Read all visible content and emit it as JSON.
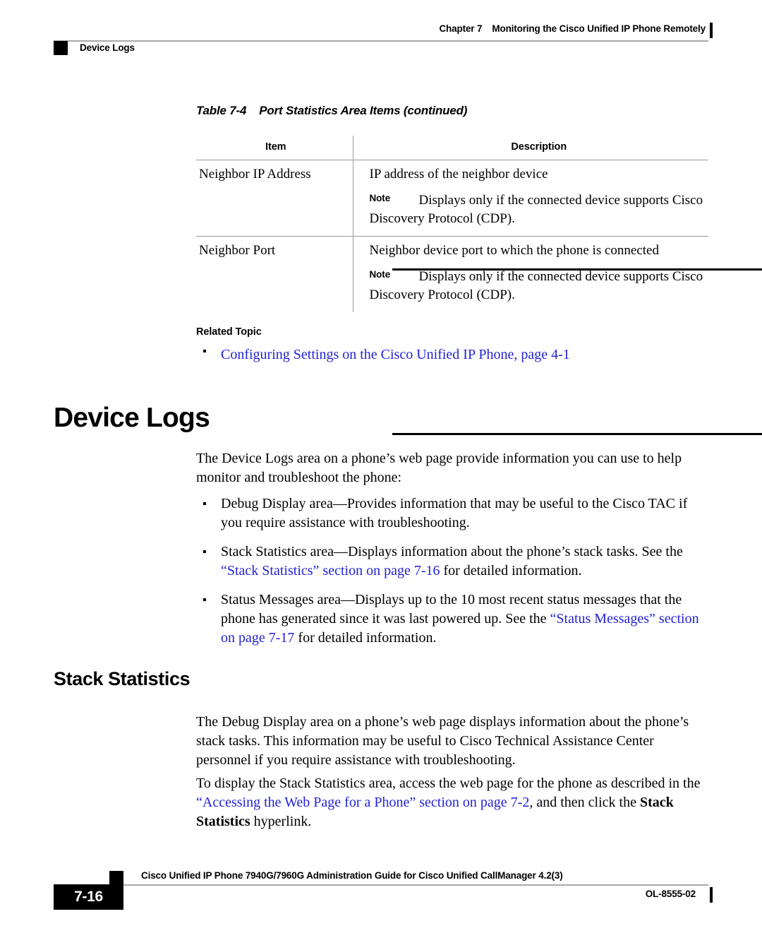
{
  "header": {
    "chapter_number": "Chapter 7",
    "chapter_title": "Monitoring the Cisco Unified IP Phone Remotely",
    "section_name": "Device Logs"
  },
  "table": {
    "caption_number": "Table 7-4",
    "caption_title": "Port Statistics Area Items (continued)",
    "columns": [
      "Item",
      "Description"
    ],
    "rows": [
      {
        "item": "Neighbor IP Address",
        "description": "IP address of the neighbor device",
        "note_label": "Note",
        "note_text": "Displays only if the connected device supports Cisco Discovery Protocol (CDP)."
      },
      {
        "item": "Neighbor Port",
        "description": "Neighbor device port to which the phone is connected",
        "note_label": "Note",
        "note_text": "Displays only if the connected device supports Cisco Discovery Protocol (CDP)."
      }
    ]
  },
  "related_topic": {
    "heading": "Related Topic",
    "link": "Configuring Settings on the Cisco Unified IP Phone, page 4-1"
  },
  "device_logs": {
    "heading": "Device Logs",
    "intro": "The Device Logs area on a phone’s web page provide information you can use to help monitor and troubleshoot the phone:",
    "bullets": [
      {
        "text_before": "Debug Display area—Provides information that may be useful to the Cisco TAC if you require assistance with troubleshooting.",
        "link": "",
        "text_after": ""
      },
      {
        "text_before": "Stack Statistics area—Displays information about the phone’s stack tasks. See the ",
        "link": "“Stack Statistics” section on page 7-16",
        "text_after": " for detailed information."
      },
      {
        "text_before": "Status Messages area—Displays up to the 10 most recent status messages that the phone has generated since it was last powered up. See the ",
        "link": "“Status Messages” section on page 7-17",
        "text_after": " for detailed information."
      }
    ]
  },
  "stack_statistics": {
    "heading": "Stack Statistics",
    "intro": "The Debug Display area on a phone’s web page displays information about the phone’s stack tasks. This information may be useful to Cisco Technical Assistance Center personnel if you require assistance with troubleshooting.",
    "access_text_before": "To display the Stack Statistics area, access the web page for the phone as described in the ",
    "access_link": "“Accessing the Web Page for a Phone” section on page 7-2",
    "access_text_mid": ", and then click the ",
    "access_bold": "Stack Statistics",
    "access_text_after": " hyperlink."
  },
  "footer": {
    "doc_title": "Cisco Unified IP Phone 7940G/7960G Administration Guide for Cisco Unified CallManager 4.2(3)",
    "page_number": "7-16",
    "doc_id": "OL-8555-02"
  },
  "colors": {
    "link": "#2222d8",
    "rule": "#a8a8a8",
    "marker": "#000000"
  }
}
